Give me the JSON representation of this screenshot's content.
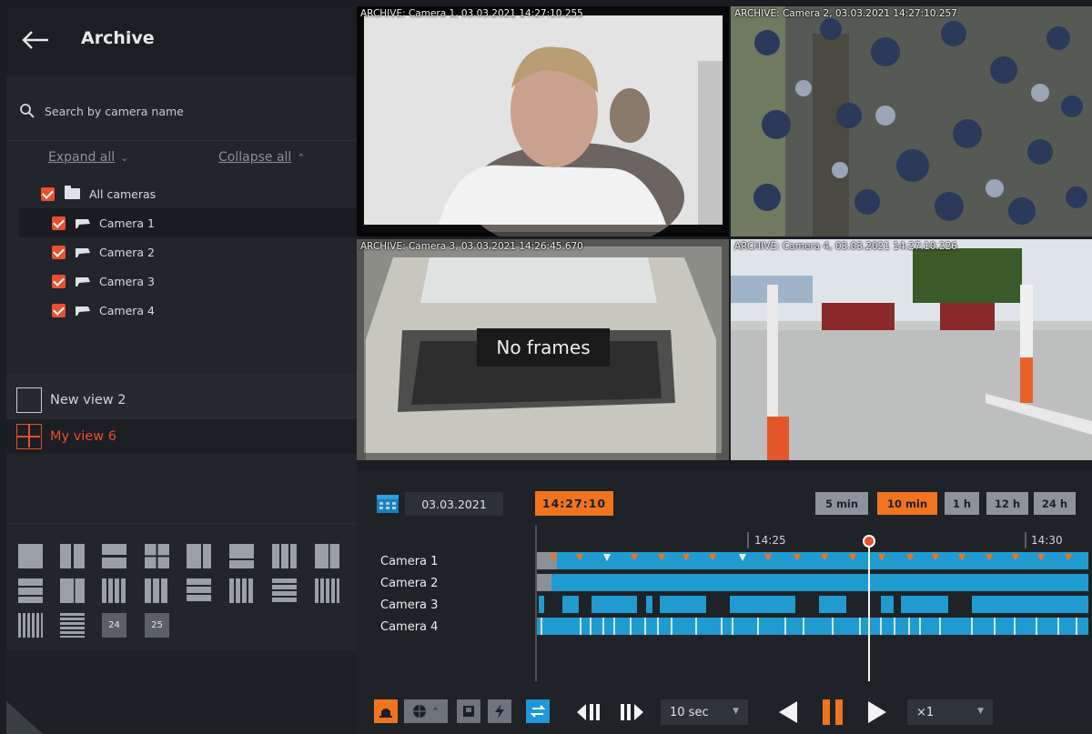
{
  "sidebar": {
    "title": "Archive",
    "search_placeholder": "Search by camera name",
    "expand_all": "Expand all",
    "collapse_all": "Collapse all",
    "tree": {
      "root": "All cameras",
      "cameras": [
        "Camera 1",
        "Camera 2",
        "Camera 3",
        "Camera 4"
      ]
    },
    "views": [
      {
        "label": "New view 2",
        "active": false
      },
      {
        "label": "My view 6",
        "active": true
      }
    ],
    "layout_numbers": [
      "24",
      "25"
    ]
  },
  "video": {
    "cells": [
      {
        "label": "ARCHIVE: Camera 1, 03.03.2021 14:27:10.255"
      },
      {
        "label": "ARCHIVE: Camera 2, 03.03.2021 14:27:10.257"
      },
      {
        "label": "ARCHIVE: Camera 3, 03.03.2021 14:26:45.670",
        "overlay": "No frames"
      },
      {
        "label": "ARCHIVE: Camera 4, 03.03.2021 14:27:10.226"
      }
    ]
  },
  "timeline": {
    "date": "03.03.2021",
    "current_time": "14:27:10",
    "scales": [
      "5 min",
      "10 min",
      "1 h",
      "12 h",
      "24 h"
    ],
    "active_scale": "10 min",
    "ruler": [
      "14:25",
      "14:30"
    ],
    "tracks": [
      "Camera 1",
      "Camera 2",
      "Camera 3",
      "Camera 4"
    ],
    "step": "10 sec",
    "speed": "×1"
  },
  "colors": {
    "accent": "#f0741f",
    "selected_red": "#e8502f",
    "track_blue": "#1f9bd0",
    "toggle_blue": "#1f97d8"
  }
}
